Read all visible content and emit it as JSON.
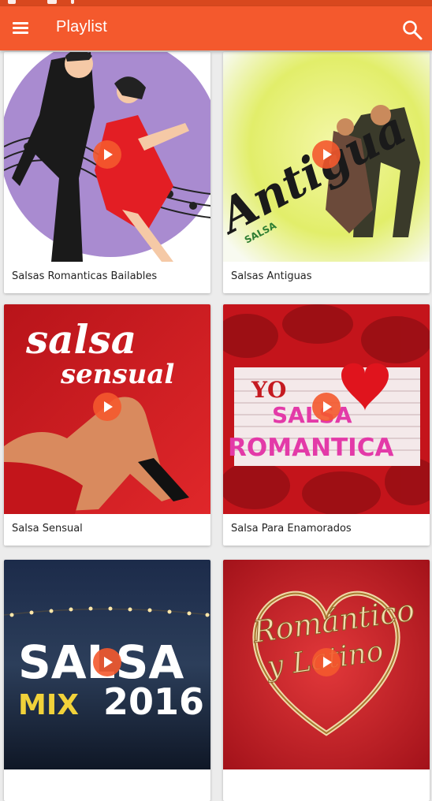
{
  "app": {
    "title": "Playlist",
    "accent_color": "#f4592d",
    "icons": {
      "menu": "menu-icon",
      "search": "search-icon",
      "play": "play-icon"
    }
  },
  "playlists": [
    {
      "label": "Salsas Romanticas Bailables",
      "art_text": []
    },
    {
      "label": "Salsas Antiguas",
      "art_text": [
        "Antigua",
        "SALSA"
      ]
    },
    {
      "label": "Salsa Sensual",
      "art_text": [
        "salsa",
        "sensual"
      ]
    },
    {
      "label": "Salsa Para Enamorados",
      "art_text": [
        "YO",
        "SALSA",
        "ROMANTICA"
      ]
    },
    {
      "label": "",
      "art_text": [
        "SALSA",
        "MIX",
        "2016"
      ]
    },
    {
      "label": "",
      "art_text": [
        "Romántico",
        "y Latino"
      ]
    }
  ]
}
